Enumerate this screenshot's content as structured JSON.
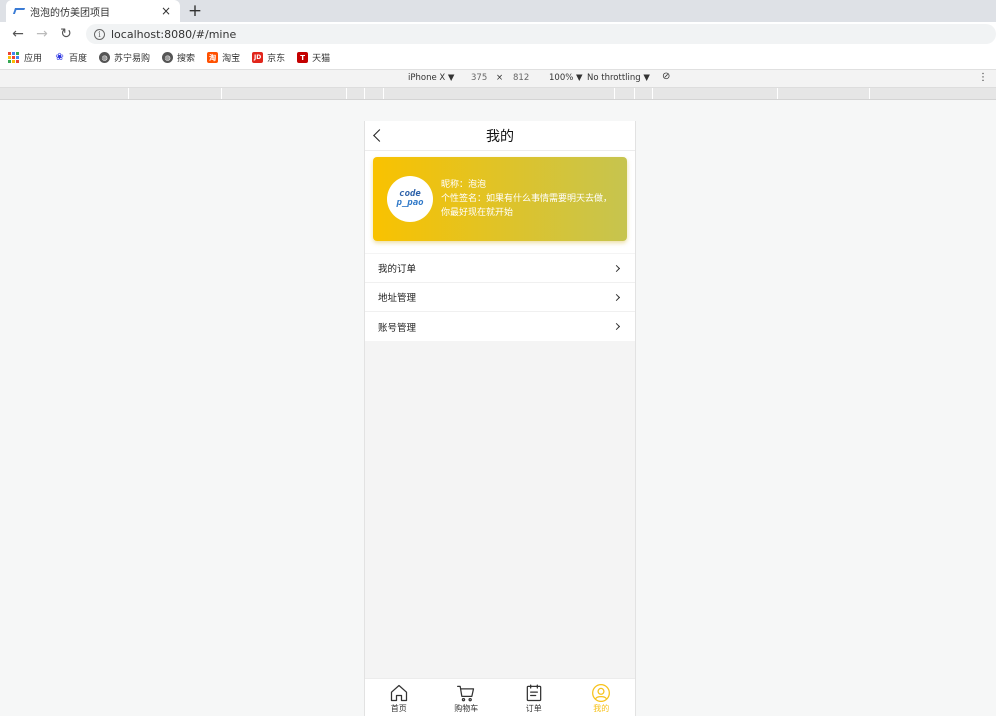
{
  "browser": {
    "tab_title": "泡泡的仿美团项目",
    "tab_close": "×",
    "new_tab": "+",
    "url": "localhost:8080/#/mine",
    "bookmarks": [
      {
        "label": "应用",
        "icon": "apps-grid-icon"
      },
      {
        "label": "百度",
        "icon": "baidu-paw-icon",
        "color": "#2932e1"
      },
      {
        "label": "苏宁易购",
        "icon": "globe-icon",
        "color": "#555555"
      },
      {
        "label": "搜索",
        "icon": "globe-icon",
        "color": "#555555"
      },
      {
        "label": "淘宝",
        "icon": "taobao-icon",
        "color": "#ff5000",
        "glyph": "淘"
      },
      {
        "label": "京东",
        "icon": "jd-icon",
        "color": "#e1251b",
        "glyph": "JD"
      },
      {
        "label": "天猫",
        "icon": "tmall-icon",
        "color": "#c40000",
        "glyph": "T"
      }
    ]
  },
  "devtools": {
    "device": "iPhone X ▼",
    "width": "375",
    "times": "×",
    "height": "812",
    "zoom": "100% ▼",
    "throttle": "No throttling ▼",
    "more": "⋮"
  },
  "app": {
    "page_title": "我的",
    "profile": {
      "nickname_line": "昵称：泡泡",
      "signature_line": "个性签名：如果有什么事情需要明天去做，你最好现在就开始",
      "avatar_text_1": "code",
      "avatar_text_2": "p_pao"
    },
    "menu": [
      {
        "label": "我的订单"
      },
      {
        "label": "地址管理"
      },
      {
        "label": "账号管理"
      }
    ],
    "tabbar": [
      {
        "label": "首页",
        "icon": "home-icon",
        "active": false
      },
      {
        "label": "购物车",
        "icon": "cart-icon",
        "active": false
      },
      {
        "label": "订单",
        "icon": "order-list-icon",
        "active": false
      },
      {
        "label": "我的",
        "icon": "user-icon",
        "active": true
      }
    ],
    "accent_color": "#f7c21b"
  }
}
